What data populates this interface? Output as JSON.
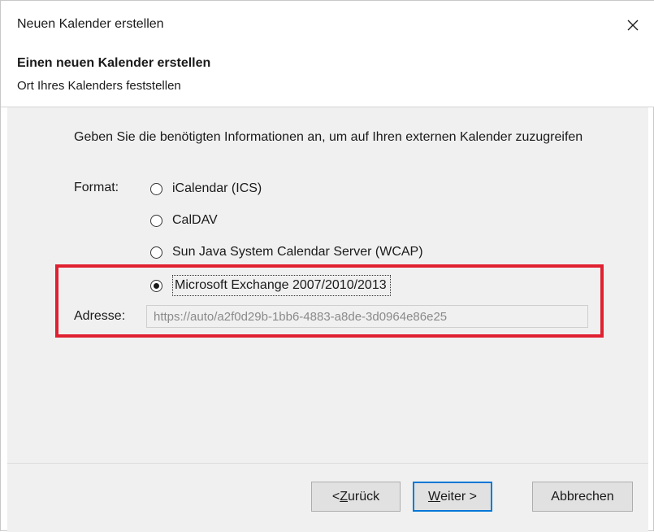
{
  "window": {
    "title": "Neuen Kalender erstellen"
  },
  "header": {
    "title": "Einen neuen Kalender erstellen",
    "subtitle": "Ort Ihres Kalenders feststellen"
  },
  "content": {
    "intro": "Geben Sie die benötigten Informationen an, um auf Ihren externen Kalender zuzugreifen",
    "format_label": "Format:",
    "formats": [
      {
        "label": "iCalendar (ICS)",
        "selected": false
      },
      {
        "label": "CalDAV",
        "selected": false
      },
      {
        "label": "Sun Java System Calendar Server (WCAP)",
        "selected": false
      },
      {
        "label": "Microsoft Exchange 2007/2010/2013",
        "selected": true
      }
    ],
    "address_label": "Adresse:",
    "address_value": "https://auto/a2f0d29b-1bb6-4883-a8de-3d0964e86e25"
  },
  "footer": {
    "back_prefix": "< ",
    "back_hotkey": "Z",
    "back_rest": "urück",
    "next_hotkey": "W",
    "next_rest": "eiter >",
    "cancel_label": "Abbrechen"
  },
  "colors": {
    "highlight": "#e02030",
    "primary_border": "#0078d7",
    "content_bg": "#f0f0f0"
  },
  "icons": {
    "close": "close-icon"
  }
}
